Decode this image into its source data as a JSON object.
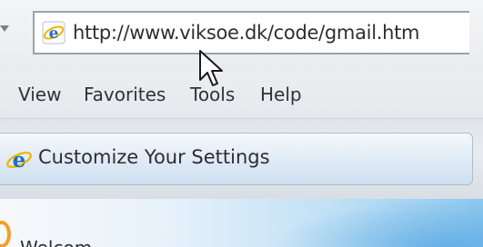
{
  "address_bar": {
    "url": "http://www.viksoe.dk/code/gmail.htm",
    "page_icon": "internet-explorer-icon",
    "dropdown_icon": "chevron-down-icon"
  },
  "menu_bar": {
    "items": [
      {
        "label": "View"
      },
      {
        "label": "Favorites"
      },
      {
        "label": "Tools"
      },
      {
        "label": "Help"
      }
    ]
  },
  "tab": {
    "icon": "internet-explorer-icon",
    "title": "Customize Your Settings"
  },
  "content": {
    "partial_text": "Welcom"
  },
  "colors": {
    "ie_blue": "#1f6fc5",
    "ie_ring": "#f4b400",
    "tab_gradient_top": "#f4f8fc",
    "content_accent": "#8cc8ee"
  }
}
